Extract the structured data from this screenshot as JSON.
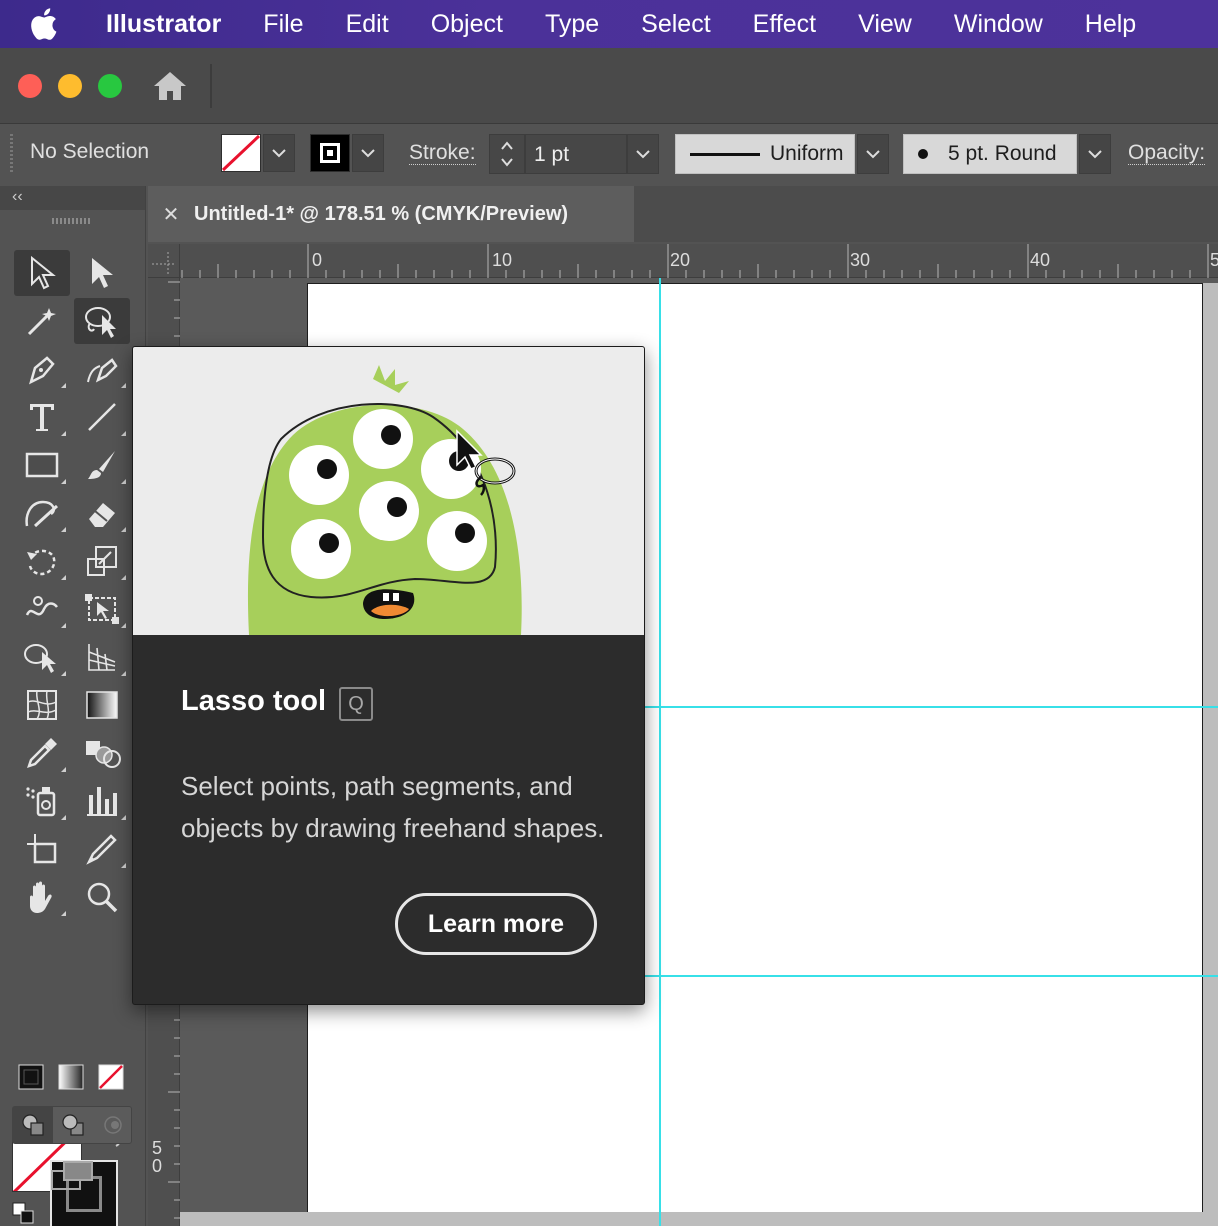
{
  "menubar": {
    "app_name": "Illustrator",
    "items": [
      "File",
      "Edit",
      "Object",
      "Type",
      "Select",
      "Effect",
      "View",
      "Window",
      "Help"
    ]
  },
  "controlbar": {
    "selection_label": "No Selection",
    "stroke_label": "Stroke:",
    "stroke_weight": "1 pt",
    "stroke_profile": "Uniform",
    "brush": "5 pt. Round",
    "opacity_label": "Opacity:"
  },
  "document": {
    "tab_title": "Untitled-1* @ 178.51 % (CMYK/Preview)",
    "ruler_h_labels": [
      "0",
      "10",
      "20",
      "30",
      "40",
      "5"
    ],
    "ruler_v_labels": [
      "5",
      "0"
    ]
  },
  "tooltip": {
    "title": "Lasso tool",
    "shortcut": "Q",
    "description": "Select points, path segments, and objects by drawing freehand shapes.",
    "button_label": "Learn more"
  },
  "colors": {
    "menubar": "#4b3199",
    "guide": "#37e0e8",
    "monster": "#a7cf5b"
  }
}
